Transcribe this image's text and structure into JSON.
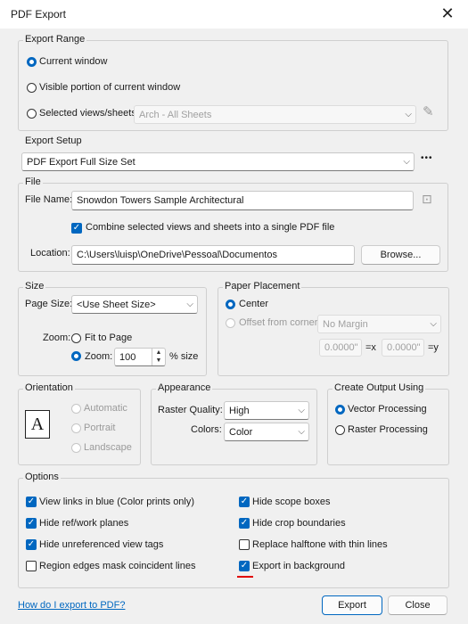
{
  "window": {
    "title": "PDF Export",
    "close_glyph": "✕"
  },
  "export_range": {
    "label": "Export Range",
    "current_window": "Current window",
    "visible_portion": "Visible portion of current window",
    "selected_views": "Selected views/sheets",
    "views_set_value": "Arch - All Sheets",
    "selected_option": "Current window"
  },
  "export_setup": {
    "label": "Export Setup",
    "value": "PDF Export Full Size Set",
    "more": "•••"
  },
  "file": {
    "label": "File",
    "file_name_label": "File Name:",
    "file_name_value": "Snowdon Towers Sample Architectural",
    "combine_label": "Combine selected views and sheets into a single PDF file",
    "combine_checked": true,
    "location_label": "Location:",
    "location_value": "C:\\Users\\luisp\\OneDrive\\Pessoal\\Documentos",
    "browse_label": "Browse..."
  },
  "size": {
    "label": "Size",
    "page_size_label": "Page Size:",
    "page_size_value": "<Use Sheet Size>",
    "zoom_label": "Zoom:",
    "fit_to_page": "Fit to Page",
    "zoom_option": "Zoom:",
    "zoom_value": "100",
    "zoom_unit": "% size"
  },
  "paper_placement": {
    "label": "Paper Placement",
    "center": "Center",
    "offset": "Offset from corner:",
    "offset_value": "No Margin",
    "x_value": "0.0000\"",
    "x_unit": "=x",
    "y_value": "0.0000\"",
    "y_unit": "=y"
  },
  "orientation": {
    "label": "Orientation",
    "automatic": "Automatic",
    "portrait": "Portrait",
    "landscape": "Landscape"
  },
  "appearance": {
    "label": "Appearance",
    "raster_quality_label": "Raster Quality:",
    "raster_quality_value": "High",
    "colors_label": "Colors:",
    "colors_value": "Color"
  },
  "create_output": {
    "label": "Create Output Using",
    "vector": "Vector Processing",
    "raster": "Raster Processing"
  },
  "options": {
    "label": "Options",
    "items": [
      {
        "label": "View links in blue (Color prints only)",
        "checked": true
      },
      {
        "label": "Hide ref/work planes",
        "checked": true
      },
      {
        "label": "Hide unreferenced view tags",
        "checked": true
      },
      {
        "label": "Region edges mask coincident lines",
        "checked": false
      },
      {
        "label": "Hide scope boxes",
        "checked": true
      },
      {
        "label": "Hide crop boundaries",
        "checked": true
      },
      {
        "label": "Replace halftone with thin lines",
        "checked": false
      },
      {
        "label": "Export in background",
        "checked": true
      }
    ]
  },
  "footer": {
    "help_link": "How do I export to PDF?",
    "export_label": "Export",
    "close_label": "Close"
  },
  "colors": {
    "accent": "#0067c0",
    "annotation": "#e00000"
  }
}
